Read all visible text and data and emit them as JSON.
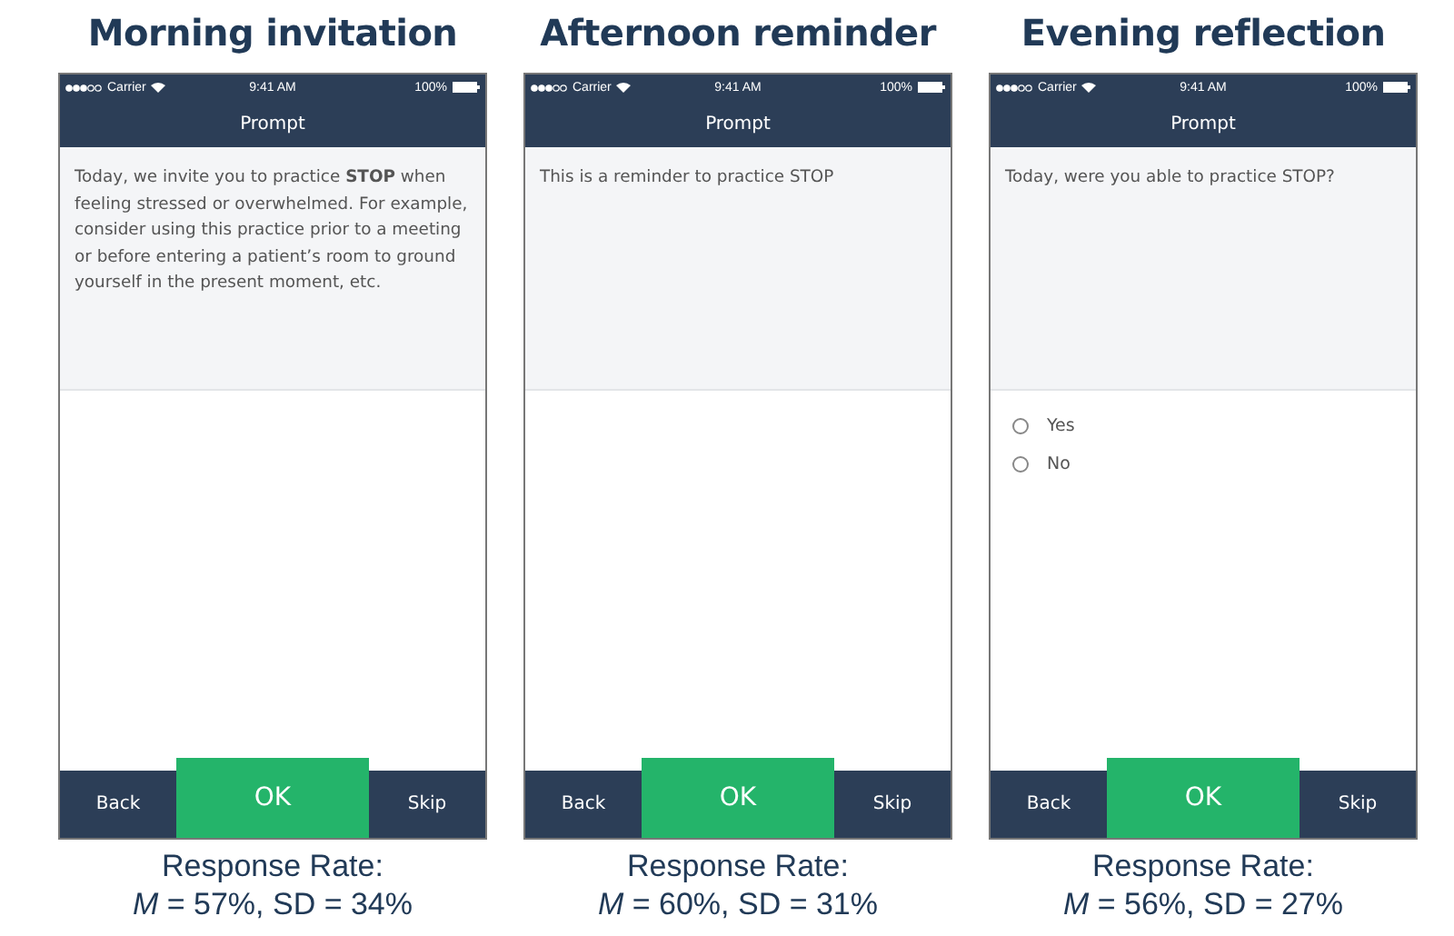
{
  "panels": [
    {
      "heading": "Morning invitation",
      "status_bar": {
        "carrier": "Carrier",
        "time": "9:41 AM",
        "battery": "100%"
      },
      "nav_title": "Prompt",
      "prompt": "Today, we invite you to practice **STOP** when feeling stressed or overwhelmed. For example, consider using this practice prior to a meeting or before entering a patient’s room to ground yourself in the present moment, etc.",
      "buttons": [
        "Back",
        "OK",
        "Skip"
      ],
      "caption": [
        "Response Rate:",
        "*M* = 57%, SD = 34%"
      ]
    },
    {
      "heading": "Afternoon reminder",
      "status_bar": {
        "carrier": "Carrier",
        "time": "9:41 AM",
        "battery": "100%"
      },
      "nav_title": "Prompt",
      "prompt": "This is a reminder to practice STOP",
      "buttons": [
        "Back",
        "OK",
        "Skip"
      ],
      "caption": [
        "Response Rate:",
        "*M* = 60%, SD = 31%"
      ]
    },
    {
      "heading": "Evening reflection",
      "status_bar": {
        "carrier": "Carrier",
        "time": "9:41 AM",
        "battery": "100%"
      },
      "nav_title": "Prompt",
      "prompt": "Today, were you able to practice STOP?",
      "options": [
        {
          "label": "Yes",
          "selected": false
        },
        {
          "label": "No",
          "selected": false
        }
      ],
      "buttons": [
        "Back",
        "OK",
        "Skip"
      ],
      "caption": [
        "Response Rate:",
        "*M* = 56%, SD = 27%"
      ]
    }
  ]
}
